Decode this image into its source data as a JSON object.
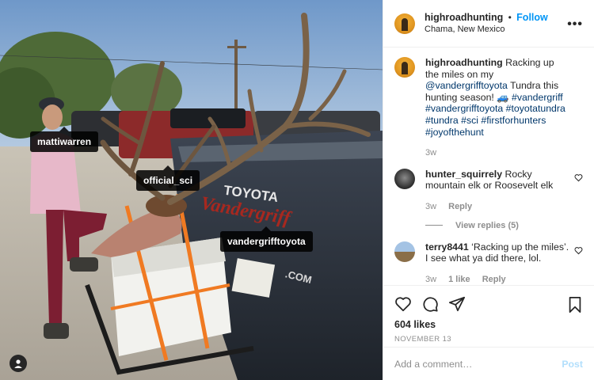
{
  "header": {
    "username": "highroadhunting",
    "separator": "•",
    "follow_label": "Follow",
    "location": "Chama, New Mexico",
    "more_label": "•••"
  },
  "photo_tags": [
    {
      "label": "mattiwarren"
    },
    {
      "label": "official_sci"
    },
    {
      "label": "vandergrifftoyota"
    }
  ],
  "photo_text": {
    "brand": "TOYOTA",
    "dealer": "Vandergriff",
    "web": ".COM"
  },
  "caption": {
    "username": "highroadhunting",
    "text_1": "Racking up the miles on my",
    "mention": "@vandergrifftoyota",
    "text_2": "Tundra this hunting season! 🚙",
    "hashtags": "#vandergriff #vandergrifftoyota #toyotatundra #tundra #sci #firstforhunters #joyofthehunt",
    "time": "3w"
  },
  "comments": [
    {
      "username": "hunter_squirrely",
      "text": "Rocky mountain elk or Roosevelt elk",
      "time": "3w",
      "likes": "",
      "reply_label": "Reply"
    },
    {
      "username": "terry8441",
      "text": "‘Racking up the miles’. I see what ya did there, lol.",
      "time": "3w",
      "likes": "1 like",
      "reply_label": "Reply"
    }
  ],
  "view_replies_label": "View replies (5)",
  "likes_count": "604 likes",
  "post_date": "NOVEMBER 13",
  "comment_input": {
    "placeholder": "Add a comment…"
  },
  "post_label": "Post",
  "colors": {
    "accent": "#0095f6",
    "link": "#00376b",
    "muted": "#8e8e8e",
    "post_disabled": "#b2dffc"
  }
}
